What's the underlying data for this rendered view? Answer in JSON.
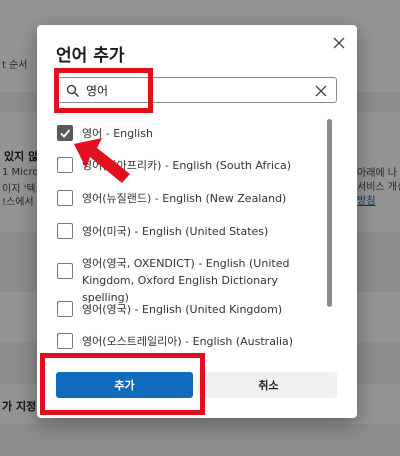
{
  "background": {
    "line1": "t 순서",
    "heading": "있지 않",
    "line2": "1 Micros",
    "line3": "이지 '텍스",
    "line4": "!스에서 ",
    "right1": "아래에 나",
    "right2": "서비스 개선",
    "right3": "방침",
    "bottom": "가 지정"
  },
  "dialog": {
    "title": "언어 추가",
    "search": {
      "value": "영어",
      "placeholder": ""
    },
    "items": [
      {
        "label": "영어 - English",
        "checked": true
      },
      {
        "label": "영어(남아프리카) - English (South Africa)",
        "checked": false
      },
      {
        "label": "영어(뉴질랜드) - English (New Zealand)",
        "checked": false
      },
      {
        "label": "영어(미국) - English (United States)",
        "checked": false
      },
      {
        "label": "영어(영국, OXENDICT) - English (United Kingdom, Oxford English Dictionary spelling)",
        "checked": false
      },
      {
        "label": "영어(영국) - English (United Kingdom)",
        "checked": false
      },
      {
        "label": "영어(오스트레일리아) - English (Australia)",
        "checked": false
      }
    ],
    "add_label": "추가",
    "cancel_label": "취소"
  },
  "colors": {
    "accent": "#0f6cbd",
    "highlight": "#e0101e",
    "checked": "#5a5a5a"
  }
}
